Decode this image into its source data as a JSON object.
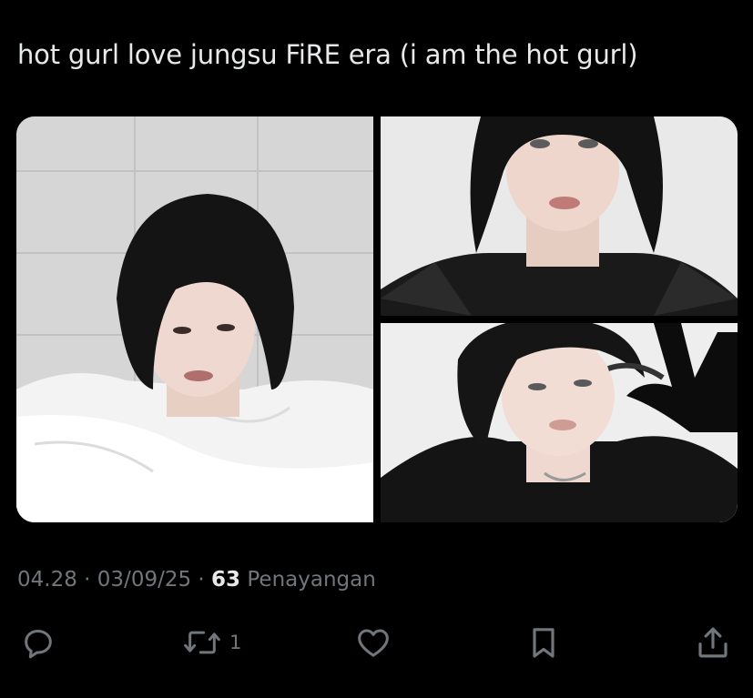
{
  "tweet": {
    "text": "hot gurl love jungsu FiRE era (i am the hot gurl)"
  },
  "media": {
    "photos": [
      {
        "position": "left",
        "subject": "person-in-white-sheet"
      },
      {
        "position": "top-right",
        "subject": "person-in-black-mesh-top"
      },
      {
        "position": "bottom-right",
        "subject": "person-with-black-glove-peace-sign"
      }
    ]
  },
  "meta": {
    "time": "04.28",
    "separator_1": "·",
    "date": "03/09/25",
    "separator_2": "·",
    "views_count": "63",
    "views_label": "Penayangan"
  },
  "actions": {
    "reply": {
      "icon": "reply-icon",
      "count": ""
    },
    "retweet": {
      "icon": "retweet-icon",
      "count": "1"
    },
    "like": {
      "icon": "heart-icon",
      "count": ""
    },
    "bookmark": {
      "icon": "bookmark-icon",
      "count": ""
    },
    "share": {
      "icon": "share-icon",
      "count": ""
    }
  },
  "colors": {
    "background": "#000000",
    "text_primary": "#e7e9ea",
    "text_secondary": "#71767b"
  }
}
